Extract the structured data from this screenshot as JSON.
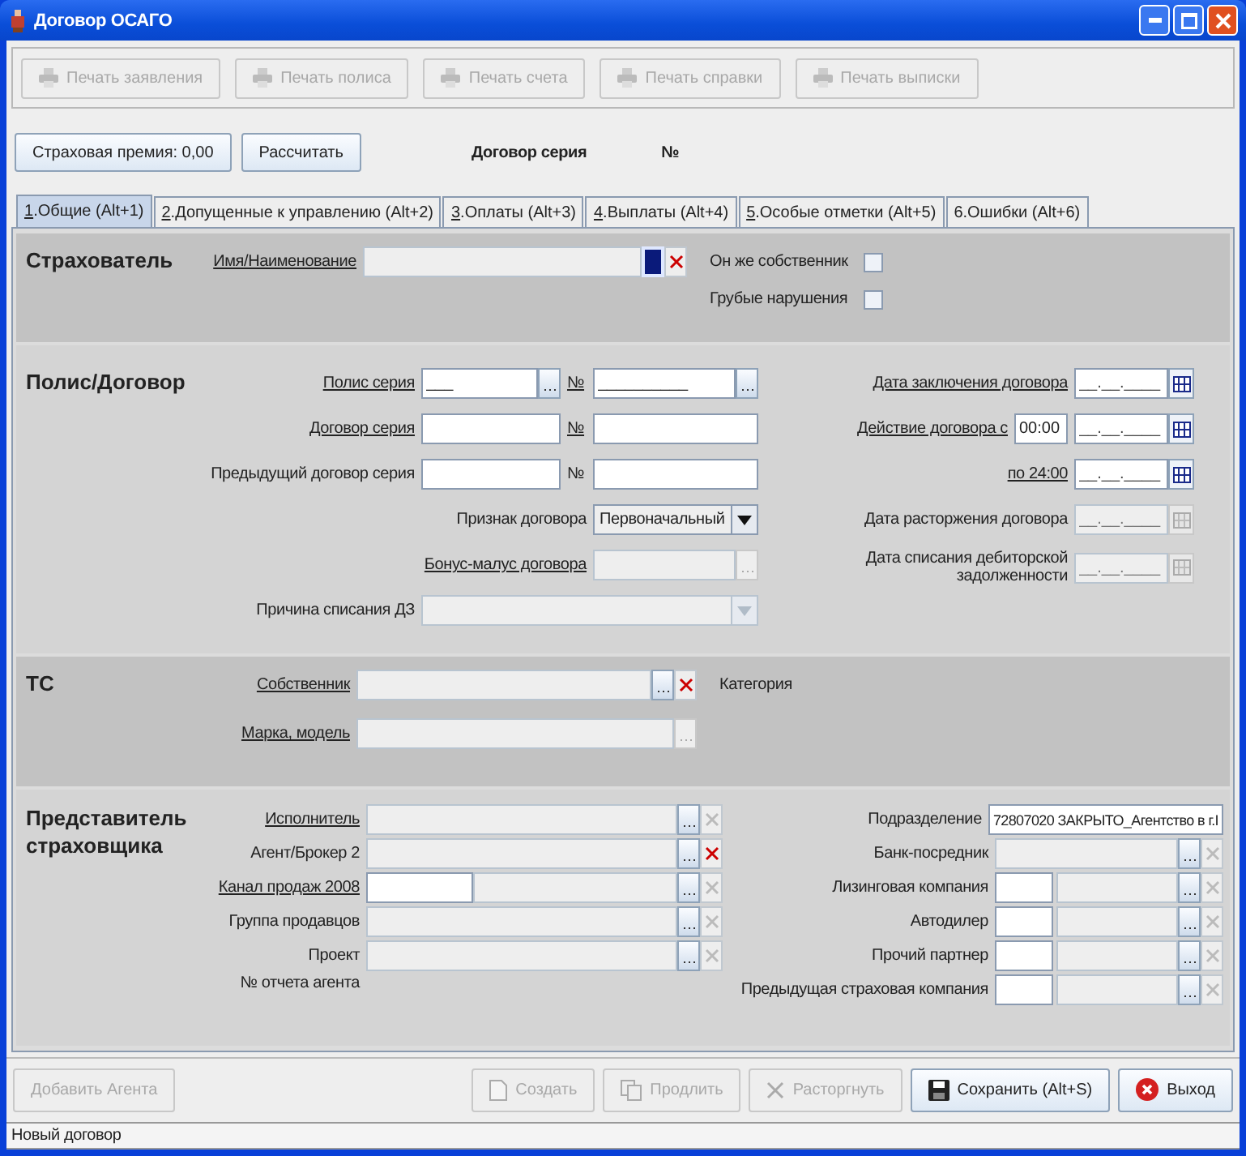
{
  "window": {
    "title": "Договор ОСАГО"
  },
  "print_buttons": [
    {
      "label": "Печать заявления",
      "disabled": true
    },
    {
      "label": "Печать полиса",
      "disabled": true
    },
    {
      "label": "Печать счета",
      "disabled": true
    },
    {
      "label": "Печать справки",
      "disabled": true
    },
    {
      "label": "Печать выписки",
      "disabled": true
    }
  ],
  "premium_button": "Страховая премия: 0,00",
  "calculate_button": "Рассчитать",
  "contract_series_label": "Договор серия",
  "contract_number_label": "№",
  "tabs": [
    {
      "label": "1.Общие (Alt+1)",
      "mnemonic": true,
      "selected": true
    },
    {
      "label": "2.Допущенные к управлению (Alt+2)",
      "mnemonic": true,
      "selected": false
    },
    {
      "label": "3.Оплаты (Alt+3)",
      "mnemonic": true,
      "selected": false
    },
    {
      "label": "4.Выплаты (Alt+4)",
      "mnemonic": true,
      "selected": false
    },
    {
      "label": "5.Особые отметки (Alt+5)",
      "mnemonic": true,
      "selected": false
    },
    {
      "label": "6.Ошибки (Alt+6)",
      "mnemonic": false,
      "selected": false
    }
  ],
  "sections": [
    {
      "title": "Страхователь",
      "left": [
        {
          "kind": "lookup",
          "label": "Имя/Наименование",
          "link": true,
          "disabled": true,
          "browse_enabled": true,
          "browse_pressed": true,
          "clear_button": true,
          "clear_enabled": true
        }
      ],
      "right": [
        {
          "kind": "checkbox",
          "label": "Он же собственник",
          "checked": false
        },
        {
          "kind": "checkbox",
          "label": "Грубые нарушения",
          "checked": false
        }
      ]
    },
    {
      "title": "Полис/Договор",
      "left": [
        {
          "kind": "series_number",
          "label": "Полис серия",
          "link": true,
          "series": "___",
          "series_button": true,
          "number_label": "№",
          "number_link": true,
          "number": "__________",
          "number_button": true
        },
        {
          "kind": "series_number",
          "label": "Договор серия",
          "link": true,
          "series_button": false,
          "number_label": "№",
          "number_link": true,
          "number_button": false
        },
        {
          "kind": "series_number",
          "label": "Предыдущий договор серия",
          "link": false,
          "series_button": false,
          "number_label": "№",
          "number_link": false,
          "number_button": false
        },
        {
          "kind": "select",
          "label": "Признак договора",
          "link": false,
          "value": "Первоначальный",
          "disabled": false
        },
        {
          "kind": "lookup",
          "label": "Бонус-малус договора",
          "link": true,
          "disabled": true,
          "browse_enabled": false,
          "browse_pressed": false,
          "clear_button": false
        },
        {
          "kind": "select",
          "label": "Причина списания ДЗ",
          "link": false,
          "disabled": true
        }
      ],
      "right": [
        {
          "kind": "date",
          "label": "Дата заключения договора",
          "link": true,
          "value": "__.__.____",
          "disabled": false
        },
        {
          "kind": "date",
          "label": "Действие договора с",
          "link": true,
          "time": "00:00",
          "value": "__.__.____",
          "disabled": false
        },
        {
          "kind": "date",
          "label": "по 24:00",
          "link": true,
          "value": "__.__.____",
          "disabled": false
        },
        {
          "kind": "date",
          "label": "Дата расторжения договора",
          "link": false,
          "value": "__.__.____",
          "disabled": true
        },
        {
          "kind": "date",
          "label": "Дата списания дебиторской задолженности",
          "link": false,
          "value": "__.__.____",
          "disabled": true
        }
      ]
    },
    {
      "title": "ТС",
      "left": [
        {
          "kind": "lookup",
          "label": "Собственник",
          "link": true,
          "disabled": true,
          "browse_enabled": true,
          "browse_pressed": false,
          "clear_button": true,
          "clear_enabled": true
        },
        {
          "kind": "lookup",
          "label": "Марка, модель",
          "link": true,
          "disabled": true,
          "browse_enabled": false,
          "browse_pressed": false,
          "clear_button": false
        }
      ],
      "right": [
        {
          "kind": "text",
          "label": "Категория"
        }
      ]
    },
    {
      "title": "Представитель страховщика",
      "left": [
        {
          "kind": "lookup",
          "label": "Исполнитель",
          "link": true,
          "disabled": true,
          "browse_enabled": true,
          "browse_pressed": false,
          "clear_button": true,
          "clear_enabled": false
        },
        {
          "kind": "lookup",
          "label": "Агент/Брокер 2",
          "link": false,
          "disabled": true,
          "browse_enabled": true,
          "browse_pressed": false,
          "clear_button": true,
          "clear_enabled": true
        },
        {
          "kind": "lookup",
          "label": "Канал продаж 2008",
          "link": true,
          "code": true,
          "disabled": true,
          "browse_enabled": true,
          "browse_pressed": false,
          "clear_button": true,
          "clear_enabled": false
        },
        {
          "kind": "lookup",
          "label": "Группа продавцов",
          "link": false,
          "disabled": true,
          "browse_enabled": true,
          "browse_pressed": false,
          "clear_button": true,
          "clear_enabled": false
        },
        {
          "kind": "lookup",
          "label": "Проект",
          "link": false,
          "disabled": true,
          "browse_enabled": true,
          "browse_pressed": false,
          "clear_button": true,
          "clear_enabled": false
        },
        {
          "kind": "text",
          "label": "№ отчета агента"
        }
      ],
      "right": [
        {
          "kind": "value",
          "label": "Подразделение",
          "value": "72807020 ЗАКРЫТО_Агентство в г.I"
        },
        {
          "kind": "lookup",
          "label": "Банк-посредник",
          "link": false,
          "disabled": true,
          "browse_enabled": true,
          "browse_pressed": false,
          "clear_button": true,
          "clear_enabled": false
        },
        {
          "kind": "lookup",
          "label": "Лизинговая компания",
          "link": false,
          "code": true,
          "disabled": true,
          "browse_enabled": true,
          "browse_pressed": false,
          "clear_button": true,
          "clear_enabled": false
        },
        {
          "kind": "lookup",
          "label": "Автодилер",
          "link": false,
          "code": true,
          "disabled": true,
          "browse_enabled": true,
          "browse_pressed": false,
          "clear_button": true,
          "clear_enabled": false
        },
        {
          "kind": "lookup",
          "label": "Прочий партнер",
          "link": false,
          "code": true,
          "disabled": true,
          "browse_enabled": true,
          "browse_pressed": false,
          "clear_button": true,
          "clear_enabled": false
        },
        {
          "kind": "lookup",
          "label": "Предыдущая страховая компания",
          "link": false,
          "code": true,
          "disabled": true,
          "browse_enabled": true,
          "browse_pressed": false,
          "clear_button": true,
          "clear_enabled": false
        }
      ]
    }
  ],
  "add_agent_button": {
    "label": "Добавить Агента",
    "disabled": true
  },
  "action_buttons": [
    {
      "kind": "create",
      "label": "Создать",
      "disabled": true
    },
    {
      "kind": "extend",
      "label": "Продлить",
      "disabled": true
    },
    {
      "kind": "terminate",
      "label": "Расторгнуть",
      "disabled": true
    },
    {
      "kind": "save",
      "label": "Сохранить (Alt+S)",
      "disabled": false
    },
    {
      "kind": "exit",
      "label": "Выход",
      "disabled": false
    }
  ],
  "status_bar": "Новый договор"
}
